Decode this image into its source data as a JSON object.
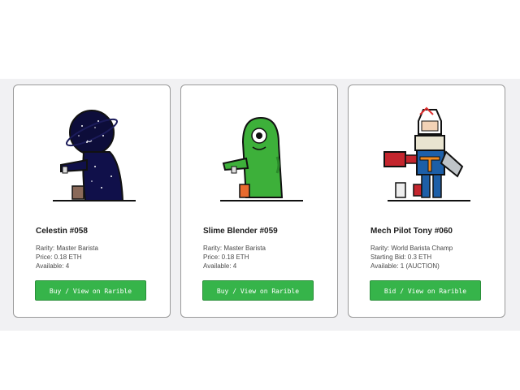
{
  "cards": [
    {
      "title": "Celestin #058",
      "rarity": "Rarity: Master Barista",
      "price": "Price: 0.18 ETH",
      "available": "Available: 4",
      "button": "Buy / View on Rarible"
    },
    {
      "title": "Slime Blender #059",
      "rarity": "Rarity: Master Barista",
      "price": "Price: 0.18 ETH",
      "available": "Available: 4",
      "button": "Buy / View on Rarible"
    },
    {
      "title": "Mech Pilot Tony #060",
      "rarity": "Rarity: World Barista Champ",
      "price": "Starting Bid: 0.3 ETH",
      "available": "Available: 1 (AUCTION)",
      "button": "Bid / View on Rarible"
    }
  ],
  "colors": {
    "button": "#36b44a",
    "card_border": "#9a9a9a",
    "band": "#f1f1f3"
  },
  "icons": [
    "celestin-barista-illustration",
    "slime-barista-illustration",
    "mech-pilot-barista-illustration"
  ]
}
